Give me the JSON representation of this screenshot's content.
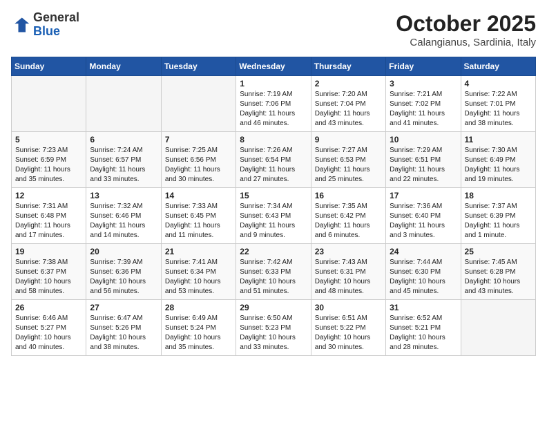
{
  "logo": {
    "general": "General",
    "blue": "Blue"
  },
  "header": {
    "month": "October 2025",
    "location": "Calangianus, Sardinia, Italy"
  },
  "weekdays": [
    "Sunday",
    "Monday",
    "Tuesday",
    "Wednesday",
    "Thursday",
    "Friday",
    "Saturday"
  ],
  "weeks": [
    [
      {
        "day": "",
        "info": ""
      },
      {
        "day": "",
        "info": ""
      },
      {
        "day": "",
        "info": ""
      },
      {
        "day": "1",
        "info": "Sunrise: 7:19 AM\nSunset: 7:06 PM\nDaylight: 11 hours and 46 minutes."
      },
      {
        "day": "2",
        "info": "Sunrise: 7:20 AM\nSunset: 7:04 PM\nDaylight: 11 hours and 43 minutes."
      },
      {
        "day": "3",
        "info": "Sunrise: 7:21 AM\nSunset: 7:02 PM\nDaylight: 11 hours and 41 minutes."
      },
      {
        "day": "4",
        "info": "Sunrise: 7:22 AM\nSunset: 7:01 PM\nDaylight: 11 hours and 38 minutes."
      }
    ],
    [
      {
        "day": "5",
        "info": "Sunrise: 7:23 AM\nSunset: 6:59 PM\nDaylight: 11 hours and 35 minutes."
      },
      {
        "day": "6",
        "info": "Sunrise: 7:24 AM\nSunset: 6:57 PM\nDaylight: 11 hours and 33 minutes."
      },
      {
        "day": "7",
        "info": "Sunrise: 7:25 AM\nSunset: 6:56 PM\nDaylight: 11 hours and 30 minutes."
      },
      {
        "day": "8",
        "info": "Sunrise: 7:26 AM\nSunset: 6:54 PM\nDaylight: 11 hours and 27 minutes."
      },
      {
        "day": "9",
        "info": "Sunrise: 7:27 AM\nSunset: 6:53 PM\nDaylight: 11 hours and 25 minutes."
      },
      {
        "day": "10",
        "info": "Sunrise: 7:29 AM\nSunset: 6:51 PM\nDaylight: 11 hours and 22 minutes."
      },
      {
        "day": "11",
        "info": "Sunrise: 7:30 AM\nSunset: 6:49 PM\nDaylight: 11 hours and 19 minutes."
      }
    ],
    [
      {
        "day": "12",
        "info": "Sunrise: 7:31 AM\nSunset: 6:48 PM\nDaylight: 11 hours and 17 minutes."
      },
      {
        "day": "13",
        "info": "Sunrise: 7:32 AM\nSunset: 6:46 PM\nDaylight: 11 hours and 14 minutes."
      },
      {
        "day": "14",
        "info": "Sunrise: 7:33 AM\nSunset: 6:45 PM\nDaylight: 11 hours and 11 minutes."
      },
      {
        "day": "15",
        "info": "Sunrise: 7:34 AM\nSunset: 6:43 PM\nDaylight: 11 hours and 9 minutes."
      },
      {
        "day": "16",
        "info": "Sunrise: 7:35 AM\nSunset: 6:42 PM\nDaylight: 11 hours and 6 minutes."
      },
      {
        "day": "17",
        "info": "Sunrise: 7:36 AM\nSunset: 6:40 PM\nDaylight: 11 hours and 3 minutes."
      },
      {
        "day": "18",
        "info": "Sunrise: 7:37 AM\nSunset: 6:39 PM\nDaylight: 11 hours and 1 minute."
      }
    ],
    [
      {
        "day": "19",
        "info": "Sunrise: 7:38 AM\nSunset: 6:37 PM\nDaylight: 10 hours and 58 minutes."
      },
      {
        "day": "20",
        "info": "Sunrise: 7:39 AM\nSunset: 6:36 PM\nDaylight: 10 hours and 56 minutes."
      },
      {
        "day": "21",
        "info": "Sunrise: 7:41 AM\nSunset: 6:34 PM\nDaylight: 10 hours and 53 minutes."
      },
      {
        "day": "22",
        "info": "Sunrise: 7:42 AM\nSunset: 6:33 PM\nDaylight: 10 hours and 51 minutes."
      },
      {
        "day": "23",
        "info": "Sunrise: 7:43 AM\nSunset: 6:31 PM\nDaylight: 10 hours and 48 minutes."
      },
      {
        "day": "24",
        "info": "Sunrise: 7:44 AM\nSunset: 6:30 PM\nDaylight: 10 hours and 45 minutes."
      },
      {
        "day": "25",
        "info": "Sunrise: 7:45 AM\nSunset: 6:28 PM\nDaylight: 10 hours and 43 minutes."
      }
    ],
    [
      {
        "day": "26",
        "info": "Sunrise: 6:46 AM\nSunset: 5:27 PM\nDaylight: 10 hours and 40 minutes."
      },
      {
        "day": "27",
        "info": "Sunrise: 6:47 AM\nSunset: 5:26 PM\nDaylight: 10 hours and 38 minutes."
      },
      {
        "day": "28",
        "info": "Sunrise: 6:49 AM\nSunset: 5:24 PM\nDaylight: 10 hours and 35 minutes."
      },
      {
        "day": "29",
        "info": "Sunrise: 6:50 AM\nSunset: 5:23 PM\nDaylight: 10 hours and 33 minutes."
      },
      {
        "day": "30",
        "info": "Sunrise: 6:51 AM\nSunset: 5:22 PM\nDaylight: 10 hours and 30 minutes."
      },
      {
        "day": "31",
        "info": "Sunrise: 6:52 AM\nSunset: 5:21 PM\nDaylight: 10 hours and 28 minutes."
      },
      {
        "day": "",
        "info": ""
      }
    ]
  ]
}
